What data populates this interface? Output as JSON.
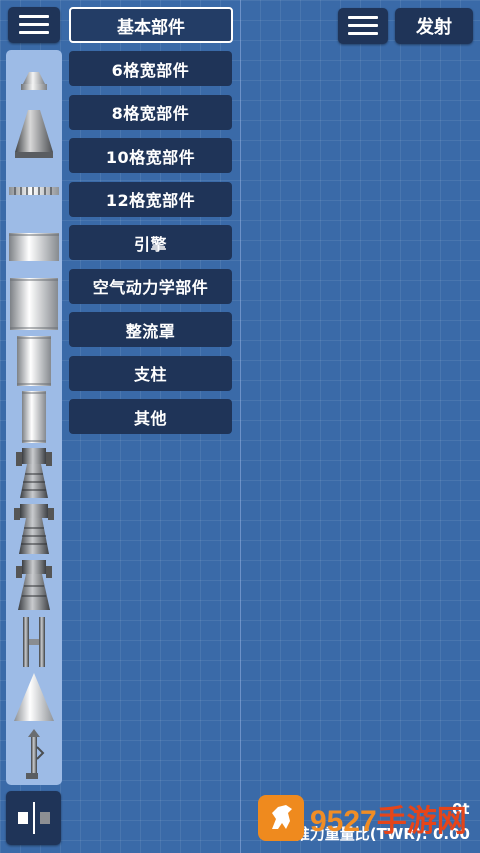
{
  "header": {
    "category_title": "基本部件",
    "launch_label": "发射",
    "menu_left_icon": "menu-icon",
    "menu_right_icon": "menu-icon"
  },
  "categories": [
    {
      "label": "6格宽部件"
    },
    {
      "label": "8格宽部件"
    },
    {
      "label": "10格宽部件"
    },
    {
      "label": "12格宽部件"
    },
    {
      "label": "引擎"
    },
    {
      "label": "空气动力学部件"
    },
    {
      "label": "整流罩"
    },
    {
      "label": "支柱"
    },
    {
      "label": "其他"
    }
  ],
  "parts": [
    {
      "icon": "command-pod-icon"
    },
    {
      "icon": "large-capsule-icon"
    },
    {
      "icon": "separator-icon"
    },
    {
      "icon": "wide-fuel-tank-icon"
    },
    {
      "icon": "large-fuel-tank-icon"
    },
    {
      "icon": "medium-fuel-tank-icon"
    },
    {
      "icon": "small-fuel-tank-icon"
    },
    {
      "icon": "engine-small-icon"
    },
    {
      "icon": "engine-medium-icon"
    },
    {
      "icon": "engine-large-icon"
    },
    {
      "icon": "strut-icon"
    },
    {
      "icon": "nose-cone-icon"
    },
    {
      "icon": "landing-leg-icon"
    }
  ],
  "readouts": {
    "mass": "0t",
    "twr": "推力重量比(TWR): 0.00"
  },
  "watermark": {
    "number": "9527",
    "text": "手游网"
  },
  "colors": {
    "background": "#3a6aa8",
    "button": "#1f3458",
    "panel": "#9dbbe6",
    "watermark_orange": "#f08d25",
    "watermark_red": "#e5451a"
  }
}
